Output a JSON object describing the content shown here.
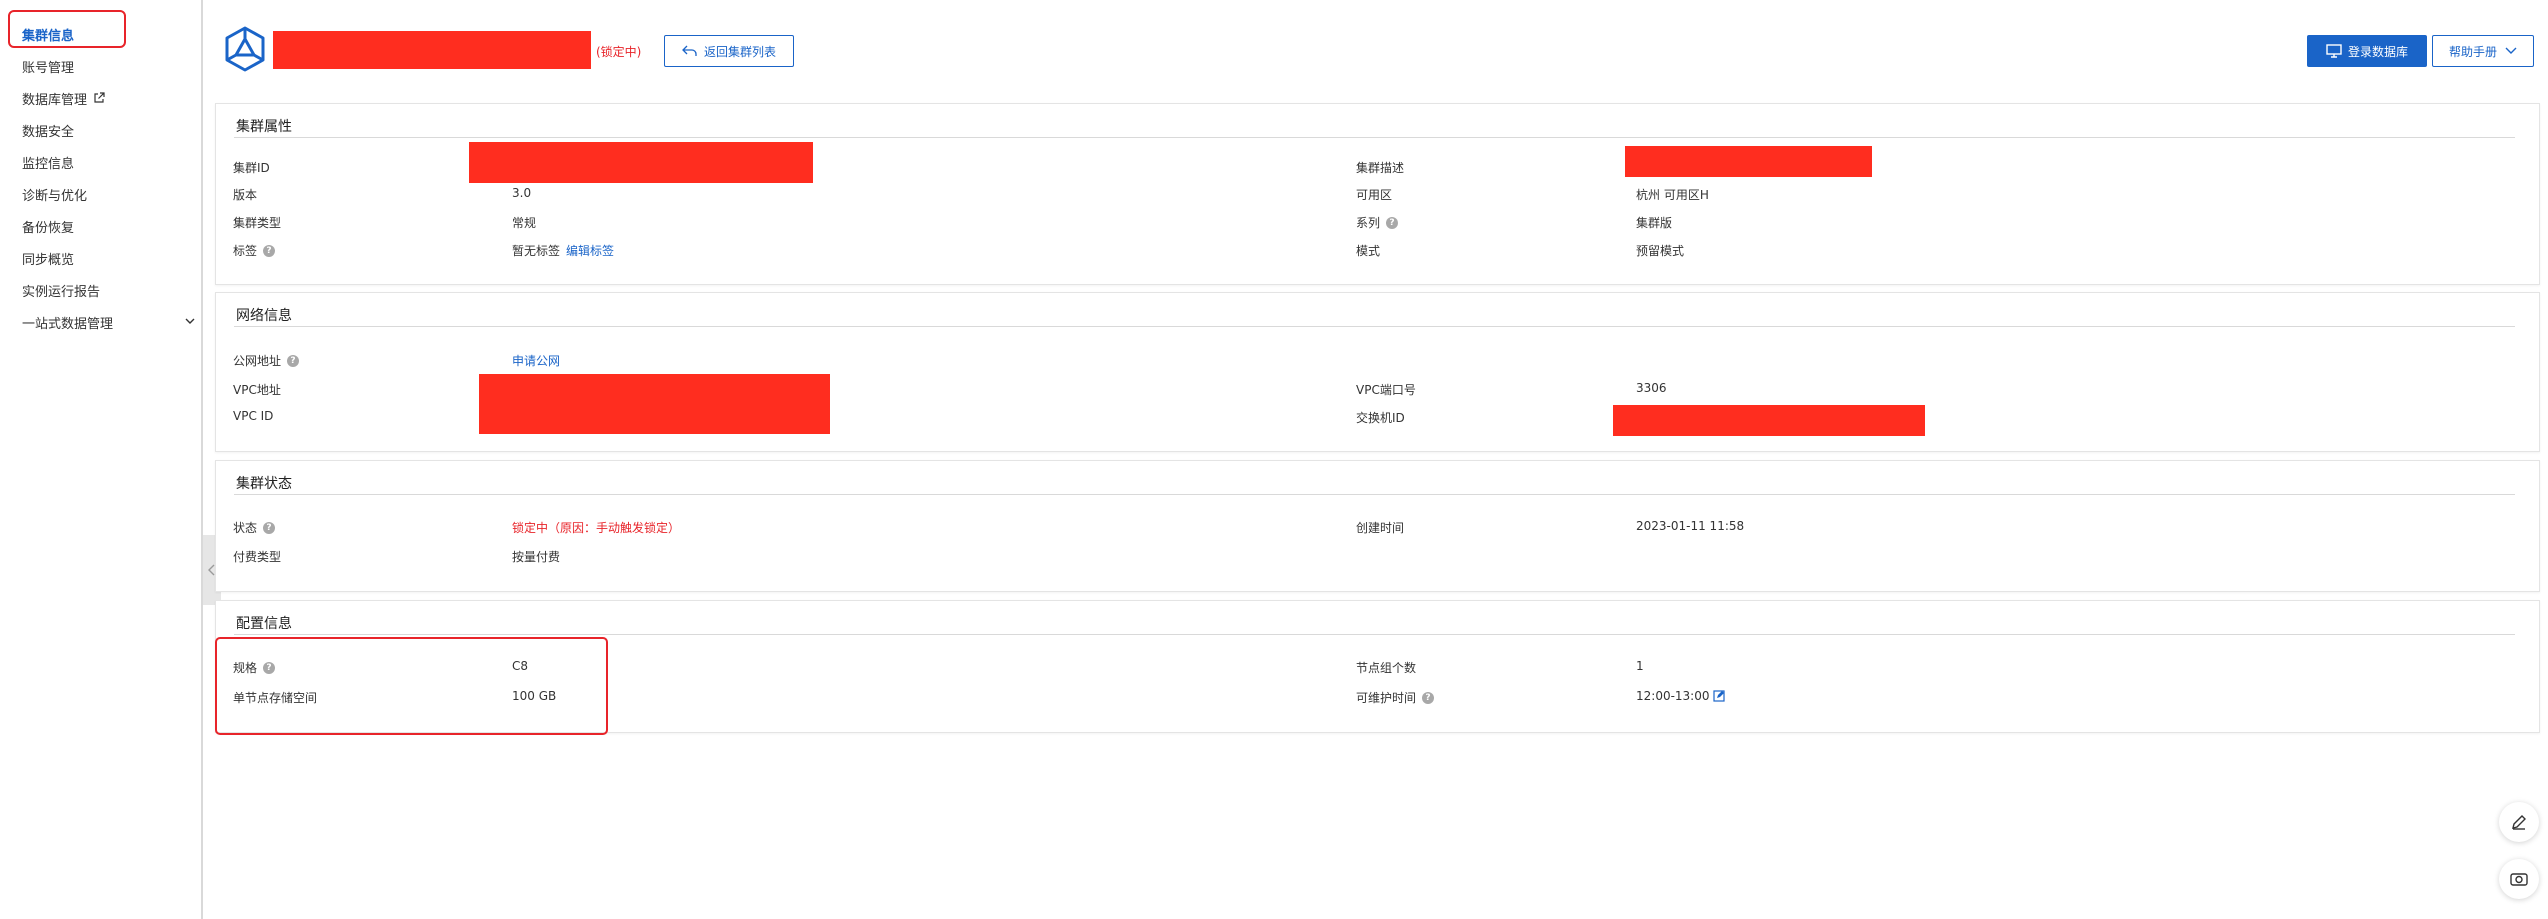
{
  "sidebar": {
    "items": [
      {
        "label": "集群信息",
        "active": true
      },
      {
        "label": "账号管理"
      },
      {
        "label": "数据库管理",
        "external": true
      },
      {
        "label": "数据安全"
      },
      {
        "label": "监控信息"
      },
      {
        "label": "诊断与优化"
      },
      {
        "label": "备份恢复"
      },
      {
        "label": "同步概览"
      },
      {
        "label": "实例运行报告"
      },
      {
        "label": "一站式数据管理",
        "expandable": true
      }
    ]
  },
  "header": {
    "status_tag": "(锁定中)",
    "back_label": "返回集群列表",
    "login_label": "登录数据库",
    "help_label": "帮助手册"
  },
  "cluster_props": {
    "title": "集群属性",
    "cluster_id_label": "集群ID",
    "version_label": "版本",
    "version_value": "3.0",
    "type_label": "集群类型",
    "type_value": "常规",
    "tag_label": "标签",
    "tag_value": "暂无标签",
    "tag_edit": "编辑标签",
    "desc_label": "集群描述",
    "zone_label": "可用区",
    "zone_value": "杭州 可用区H",
    "series_label": "系列",
    "series_value": "集群版",
    "mode_label": "模式",
    "mode_value": "预留模式"
  },
  "network": {
    "title": "网络信息",
    "public_label": "公网地址",
    "public_action": "申请公网",
    "vpc_addr_label": "VPC地址",
    "vpc_id_label": "VPC ID",
    "vpc_port_label": "VPC端口号",
    "vpc_port_value": "3306",
    "switch_label": "交换机ID"
  },
  "status": {
    "title": "集群状态",
    "state_label": "状态",
    "state_value": "锁定中（原因：手动触发锁定）",
    "billing_label": "付费类型",
    "billing_value": "按量付费",
    "created_label": "创建时间",
    "created_value": "2023-01-11 11:58"
  },
  "config": {
    "title": "配置信息",
    "spec_label": "规格",
    "spec_value": "C8",
    "storage_label": "单节点存储空间",
    "storage_value": "100 GB",
    "nodes_label": "节点组个数",
    "nodes_value": "1",
    "maint_label": "可维护时间",
    "maint_value": "12:00-13:00"
  },
  "colors": {
    "accent": "#1a64c8",
    "danger": "#e8242a",
    "redaction": "#ff2d1f"
  }
}
